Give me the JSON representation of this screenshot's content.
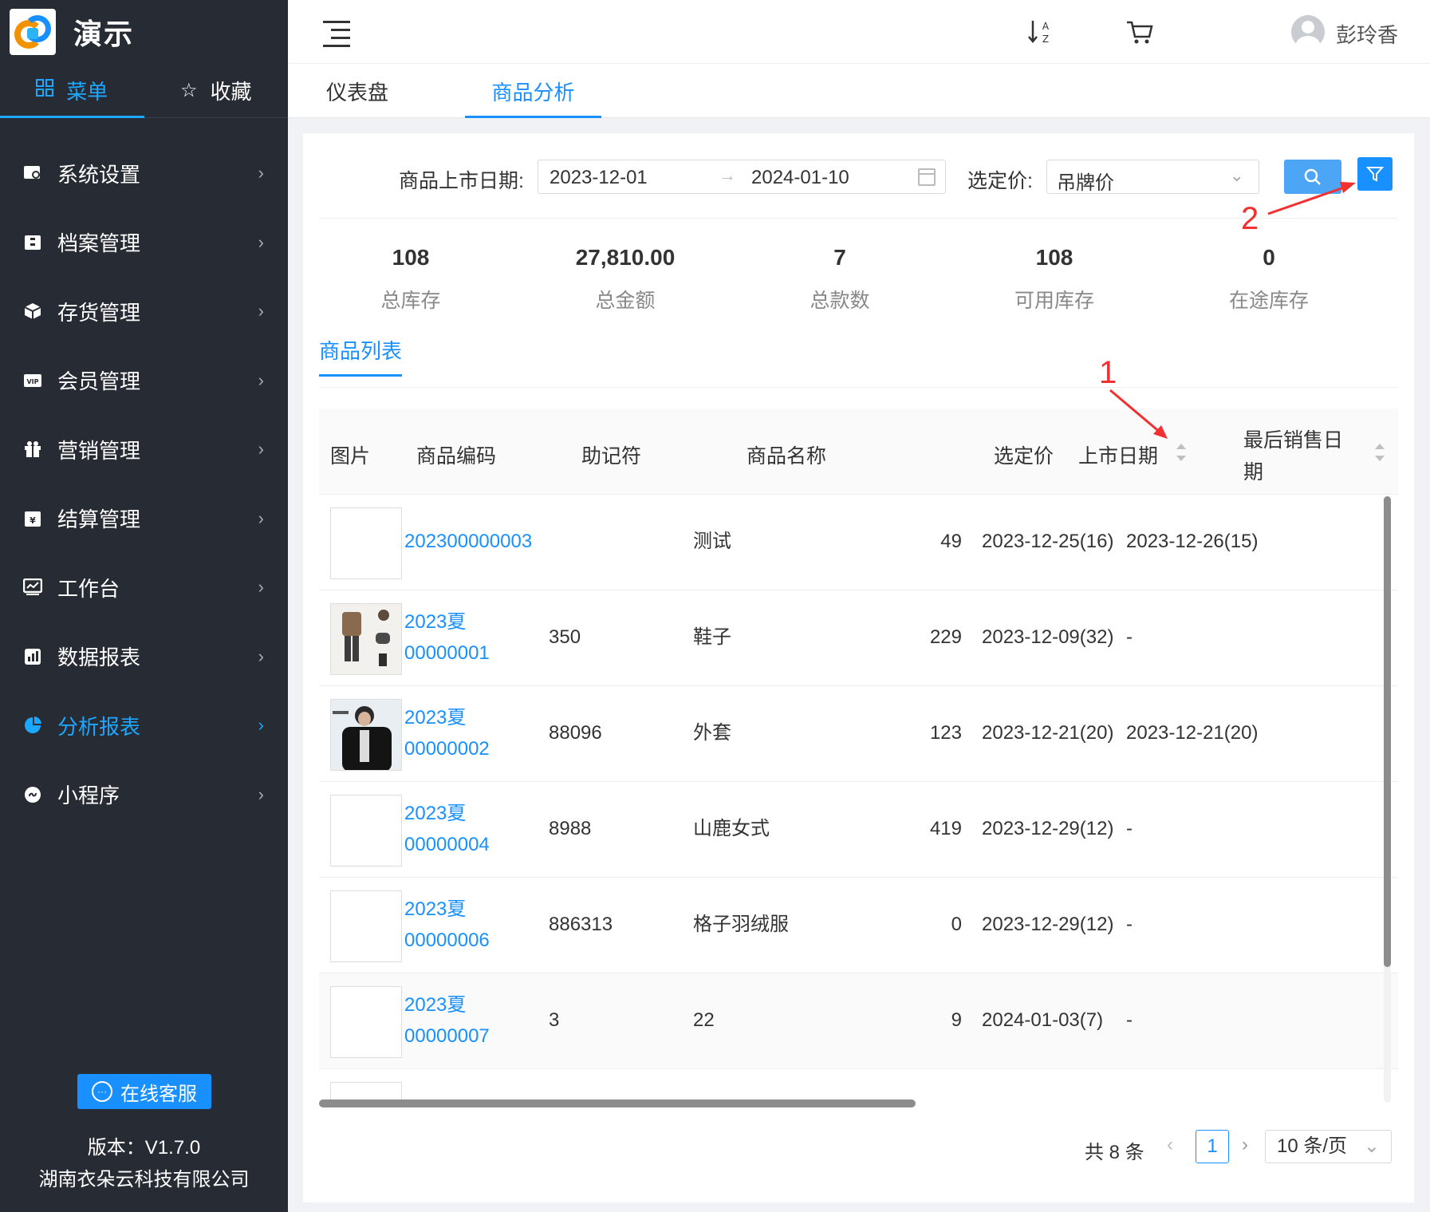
{
  "sidebar": {
    "app_title": "演示",
    "tabs": [
      {
        "label": "菜单",
        "icon": "grid-icon"
      },
      {
        "label": "收藏",
        "icon": "star-icon"
      }
    ],
    "menu_items": [
      {
        "label": "系统设置",
        "icon": "settings-icon"
      },
      {
        "label": "档案管理",
        "icon": "archive-icon"
      },
      {
        "label": "存货管理",
        "icon": "box-icon"
      },
      {
        "label": "会员管理",
        "icon": "vip-icon"
      },
      {
        "label": "营销管理",
        "icon": "gift-icon"
      },
      {
        "label": "结算管理",
        "icon": "settlement-icon"
      },
      {
        "label": "工作台",
        "icon": "workbench-icon"
      },
      {
        "label": "数据报表",
        "icon": "report-icon"
      },
      {
        "label": "分析报表",
        "icon": "pie-chart-icon",
        "active": true
      },
      {
        "label": "小程序",
        "icon": "miniprogram-icon"
      }
    ],
    "service_button": "在线客服",
    "version": "版本：V1.7.0",
    "company": "湖南衣朵云科技有限公司"
  },
  "header": {
    "username": "彭玲香"
  },
  "page_tabs": [
    {
      "label": "仪表盘"
    },
    {
      "label": "商品分析",
      "active": true
    }
  ],
  "filters": {
    "date_label": "商品上市日期:",
    "date_start": "2023-12-01",
    "date_end": "2024-01-10",
    "price_label": "选定价:",
    "price_value": "吊牌价"
  },
  "stats": [
    {
      "value": "108",
      "label": "总库存"
    },
    {
      "value": "27,810.00",
      "label": "总金额"
    },
    {
      "value": "7",
      "label": "总款数"
    },
    {
      "value": "108",
      "label": "可用库存"
    },
    {
      "value": "0",
      "label": "在途库存"
    }
  ],
  "list_tab": "商品列表",
  "table": {
    "headers": {
      "image": "图片",
      "code": "商品编码",
      "mnemonic": "助记符",
      "name": "商品名称",
      "price": "选定价",
      "launch_date": "上市日期",
      "last_sale_line1": "最后销售日",
      "last_sale_line2": "期"
    },
    "rows": [
      {
        "code1": "202300000003",
        "code2": "",
        "mnemonic": "",
        "name": "测试",
        "price": "49",
        "launch": "2023-12-25(16)",
        "last_sale": "2023-12-26(15)",
        "thumb": "empty"
      },
      {
        "code1": "2023夏",
        "code2": "00000001",
        "mnemonic": "350",
        "name": "鞋子",
        "price": "229",
        "launch": "2023-12-09(32)",
        "last_sale": "-",
        "thumb": "outfit"
      },
      {
        "code1": "2023夏",
        "code2": "00000002",
        "mnemonic": "88096",
        "name": "外套",
        "price": "123",
        "launch": "2023-12-21(20)",
        "last_sale": "2023-12-21(20)",
        "thumb": "jacket"
      },
      {
        "code1": "2023夏",
        "code2": "00000004",
        "mnemonic": "8988",
        "name": "山鹿女式",
        "price": "419",
        "launch": "2023-12-29(12)",
        "last_sale": "-",
        "thumb": "empty"
      },
      {
        "code1": "2023夏",
        "code2": "00000006",
        "mnemonic": "886313",
        "name": "格子羽绒服",
        "price": "0",
        "launch": "2023-12-29(12)",
        "last_sale": "-",
        "thumb": "empty"
      },
      {
        "code1": "2023夏",
        "code2": "00000007",
        "mnemonic": "3",
        "name": "22",
        "price": "9",
        "launch": "2024-01-03(7)",
        "last_sale": "-",
        "thumb": "empty"
      }
    ]
  },
  "pagination": {
    "total": "共 8 条",
    "current": "1",
    "page_size": "10 条/页"
  },
  "annotations": {
    "one": "1",
    "two": "2"
  }
}
